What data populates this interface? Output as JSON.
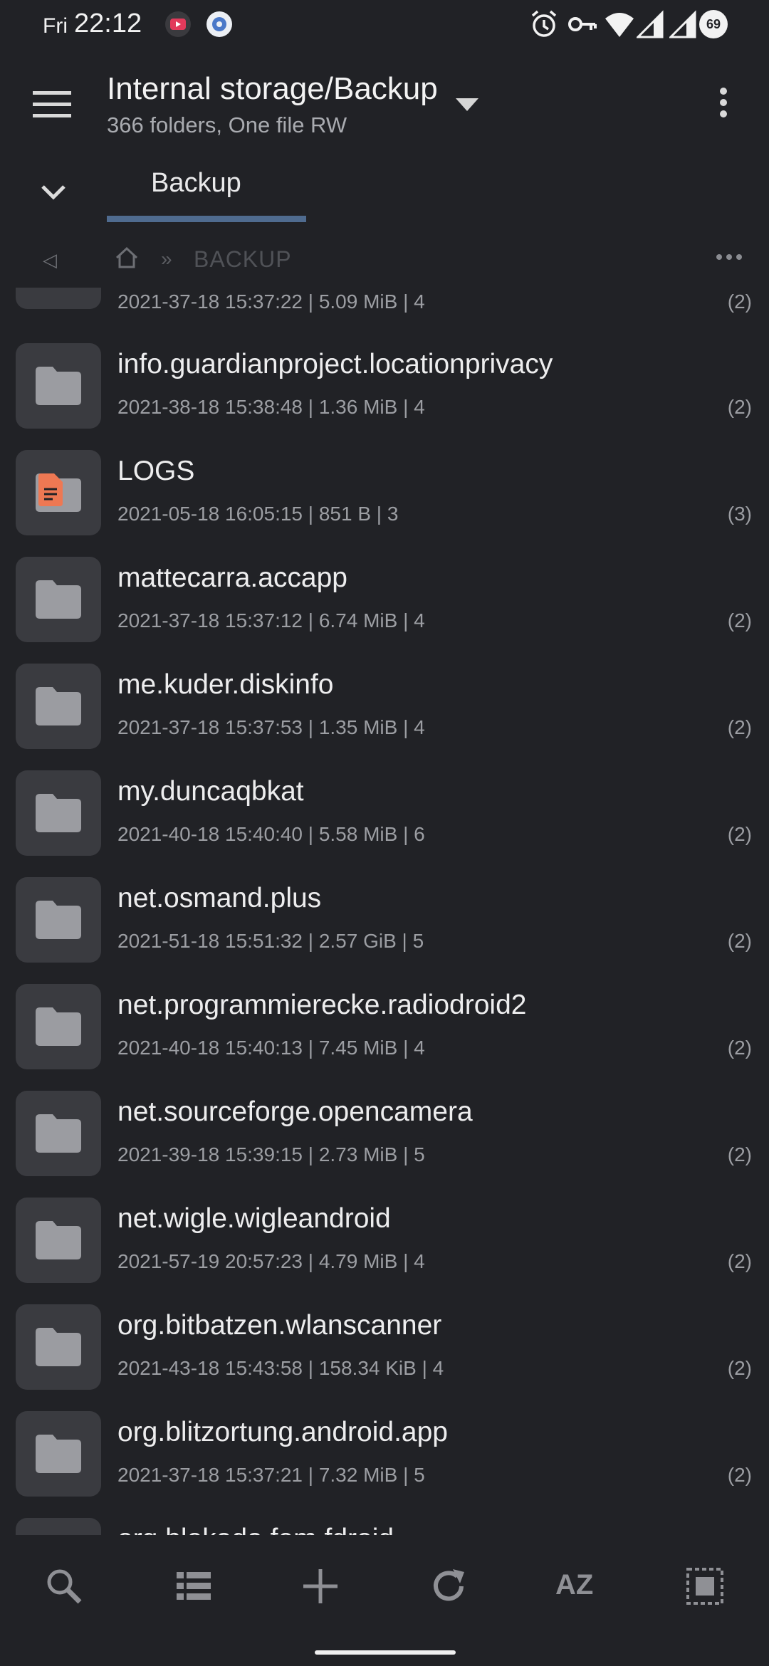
{
  "status_bar": {
    "day": "Fri",
    "time": "22:12",
    "battery": "69",
    "icons": [
      "youtube-icon",
      "settings-notification-icon",
      "alarm-icon",
      "vpn-key-icon",
      "wifi-icon",
      "signal-icon",
      "signal-icon",
      "battery-icon"
    ]
  },
  "app_bar": {
    "title": "Internal storage/Backup",
    "subtitle": "366 folders, One file RW"
  },
  "tab": {
    "label": "Backup"
  },
  "breadcrumb": {
    "back": "◁",
    "separator": "»",
    "current": "BACKUP"
  },
  "files": [
    {
      "meta": "2021-37-18 15:37:22 | 5.09 MiB | 4",
      "count": "(2)"
    },
    {
      "name": "info.guardianproject.locationprivacy",
      "meta": "2021-38-18 15:38:48 | 1.36 MiB | 4",
      "count": "(2)"
    },
    {
      "name": "LOGS",
      "meta": "2021-05-18 16:05:15 | 851 B | 3",
      "count": "(3)"
    },
    {
      "name": "mattecarra.accapp",
      "meta": "2021-37-18 15:37:12 | 6.74 MiB | 4",
      "count": "(2)"
    },
    {
      "name": "me.kuder.diskinfo",
      "meta": "2021-37-18 15:37:53 | 1.35 MiB | 4",
      "count": "(2)"
    },
    {
      "name": "my.duncaqbkat",
      "meta": "2021-40-18 15:40:40 | 5.58 MiB | 6",
      "count": "(2)"
    },
    {
      "name": "net.osmand.plus",
      "meta": "2021-51-18 15:51:32 | 2.57 GiB | 5",
      "count": "(2)"
    },
    {
      "name": "net.programmierecke.radiodroid2",
      "meta": "2021-40-18 15:40:13 | 7.45 MiB | 4",
      "count": "(2)"
    },
    {
      "name": "net.sourceforge.opencamera",
      "meta": "2021-39-18 15:39:15 | 2.73 MiB | 5",
      "count": "(2)"
    },
    {
      "name": "net.wigle.wigleandroid",
      "meta": "2021-57-19 20:57:23 | 4.79 MiB | 4",
      "count": "(2)"
    },
    {
      "name": "org.bitbatzen.wlanscanner",
      "meta": "2021-43-18 15:43:58 | 158.34  KiB | 4",
      "count": "(2)"
    },
    {
      "name": "org.blitzortung.android.app",
      "meta": "2021-37-18 15:37:21 | 7.32 MiB | 5",
      "count": "(2)"
    },
    {
      "name": "org.blokada.fem.fdroid"
    }
  ],
  "bottom_bar": {
    "sort_label": "AZ"
  },
  "colors": {
    "background": "#212226",
    "tab_indicator": "#4f6b8f",
    "log_badge": "#ee7853"
  }
}
